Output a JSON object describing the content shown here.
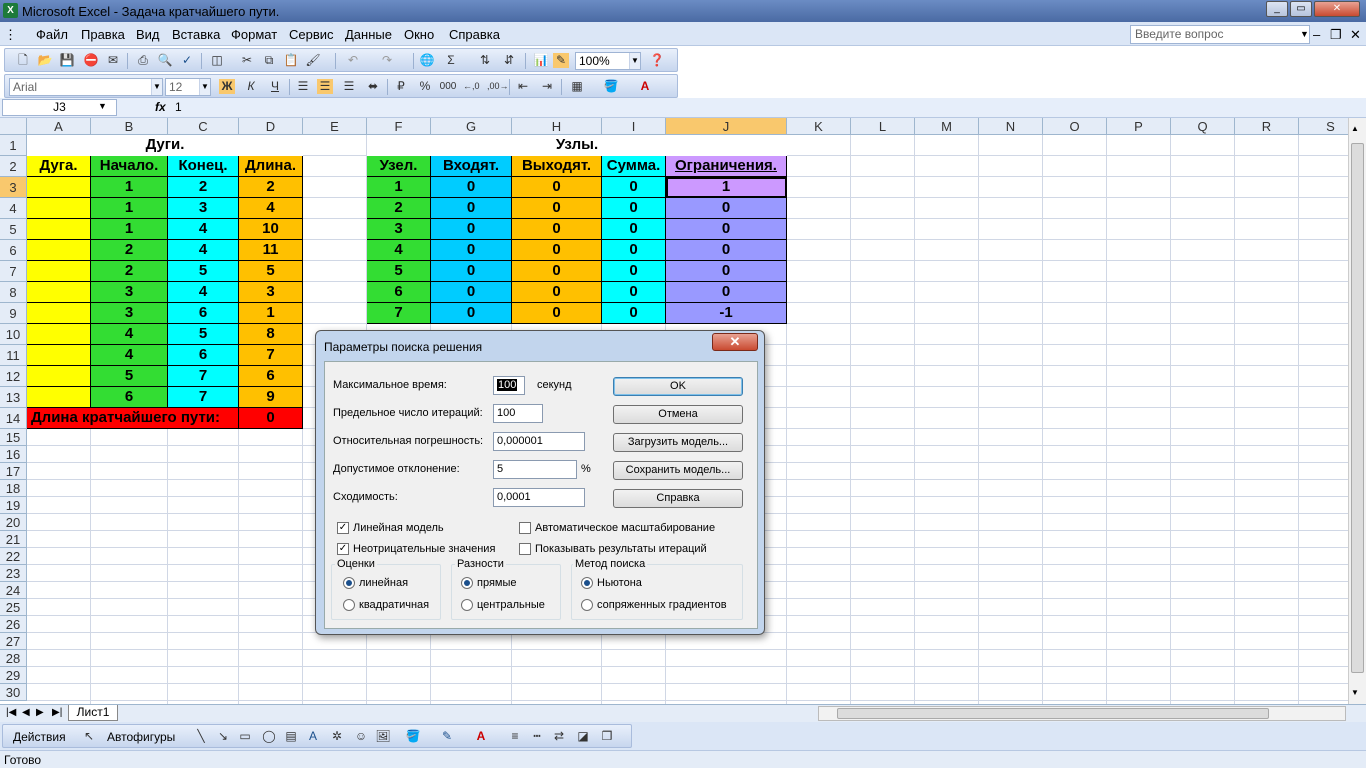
{
  "window": {
    "title": "Microsoft Excel - Задача кратчайшего пути.",
    "app_icon": "X"
  },
  "menu": {
    "items": [
      "Файл",
      "Правка",
      "Вид",
      "Вставка",
      "Формат",
      "Сервис",
      "Данные",
      "Окно",
      "Справка"
    ],
    "ask_placeholder": "Введите вопрос"
  },
  "toolbar": {
    "zoom": "100%",
    "font": "Arial",
    "size": "12",
    "bold": "Ж",
    "italic": "К",
    "underline": "Ч",
    "percent": "%",
    "thousands": "000"
  },
  "formula": {
    "namebox": "J3",
    "fx": "fx",
    "value": "1"
  },
  "columns": [
    "A",
    "B",
    "C",
    "D",
    "E",
    "F",
    "G",
    "H",
    "I",
    "J",
    "K",
    "L",
    "M",
    "N",
    "O",
    "P",
    "Q",
    "R",
    "S"
  ],
  "rows": [
    "1",
    "2",
    "3",
    "4",
    "5",
    "6",
    "7",
    "8",
    "9",
    "10",
    "11",
    "12",
    "13",
    "14",
    "15",
    "16",
    "17",
    "18",
    "19",
    "20",
    "21",
    "22",
    "23",
    "24",
    "25",
    "26",
    "27",
    "28",
    "29",
    "30"
  ],
  "arcs": {
    "title": "Дуги.",
    "headers": [
      "Дуга.",
      "Начало.",
      "Конец.",
      "Длина."
    ],
    "rows": [
      [
        "",
        "1",
        "2",
        "2"
      ],
      [
        "",
        "1",
        "3",
        "4"
      ],
      [
        "",
        "1",
        "4",
        "10"
      ],
      [
        "",
        "2",
        "4",
        "11"
      ],
      [
        "",
        "2",
        "5",
        "5"
      ],
      [
        "",
        "3",
        "4",
        "3"
      ],
      [
        "",
        "3",
        "6",
        "1"
      ],
      [
        "",
        "4",
        "5",
        "8"
      ],
      [
        "",
        "4",
        "6",
        "7"
      ],
      [
        "",
        "5",
        "7",
        "6"
      ],
      [
        "",
        "6",
        "7",
        "9"
      ]
    ],
    "total_label": "Длина кратчайшего пути:",
    "total_value": "0"
  },
  "nodes": {
    "title": "Узлы.",
    "headers": [
      "Узел.",
      "Входят.",
      "Выходят.",
      "Сумма.",
      "Ограничения."
    ],
    "rows": [
      [
        "1",
        "0",
        "0",
        "0",
        "1"
      ],
      [
        "2",
        "0",
        "0",
        "0",
        "0"
      ],
      [
        "3",
        "0",
        "0",
        "0",
        "0"
      ],
      [
        "4",
        "0",
        "0",
        "0",
        "0"
      ],
      [
        "5",
        "0",
        "0",
        "0",
        "0"
      ],
      [
        "6",
        "0",
        "0",
        "0",
        "0"
      ],
      [
        "7",
        "0",
        "0",
        "0",
        "-1"
      ]
    ]
  },
  "dialog": {
    "title": "Параметры поиска решения",
    "close": "✕",
    "fields": [
      {
        "label": "Максимальное время:",
        "value": "100",
        "suffix": "секунд"
      },
      {
        "label": "Предельное число итераций:",
        "value": "100",
        "suffix": ""
      },
      {
        "label": "Относительная погрешность:",
        "value": "0,000001",
        "suffix": ""
      },
      {
        "label": "Допустимое отклонение:",
        "value": "5",
        "suffix": "%"
      },
      {
        "label": "Сходимость:",
        "value": "0,0001",
        "suffix": ""
      }
    ],
    "buttons": [
      "OK",
      "Отмена",
      "Загрузить модель...",
      "Сохранить модель...",
      "Справка"
    ],
    "checks": [
      {
        "label": "Линейная модель",
        "checked": true
      },
      {
        "label": "Неотрицательные значения",
        "checked": true
      },
      {
        "label": "Автоматическое масштабирование",
        "checked": false
      },
      {
        "label": "Показывать результаты итераций",
        "checked": false
      }
    ],
    "groups": [
      {
        "title": "Оценки",
        "options": [
          "линейная",
          "квадратичная"
        ],
        "selected": 0
      },
      {
        "title": "Разности",
        "options": [
          "прямые",
          "центральные"
        ],
        "selected": 0
      },
      {
        "title": "Метод поиска",
        "options": [
          "Ньютона",
          "сопряженных градиентов"
        ],
        "selected": 0
      }
    ]
  },
  "sheet_tab": "Лист1",
  "drawing": {
    "actions": "Действия",
    "autoshapes": "Автофигуры"
  },
  "status": "Готово",
  "colors": {
    "yellow": "#ffff00",
    "green": "#33dd33",
    "cyan": "#00ffff",
    "orange": "#ffc000",
    "skyblue": "#00ccff",
    "violet": "#9999ff",
    "lilac": "#cc99ff",
    "red": "#ff0000"
  }
}
